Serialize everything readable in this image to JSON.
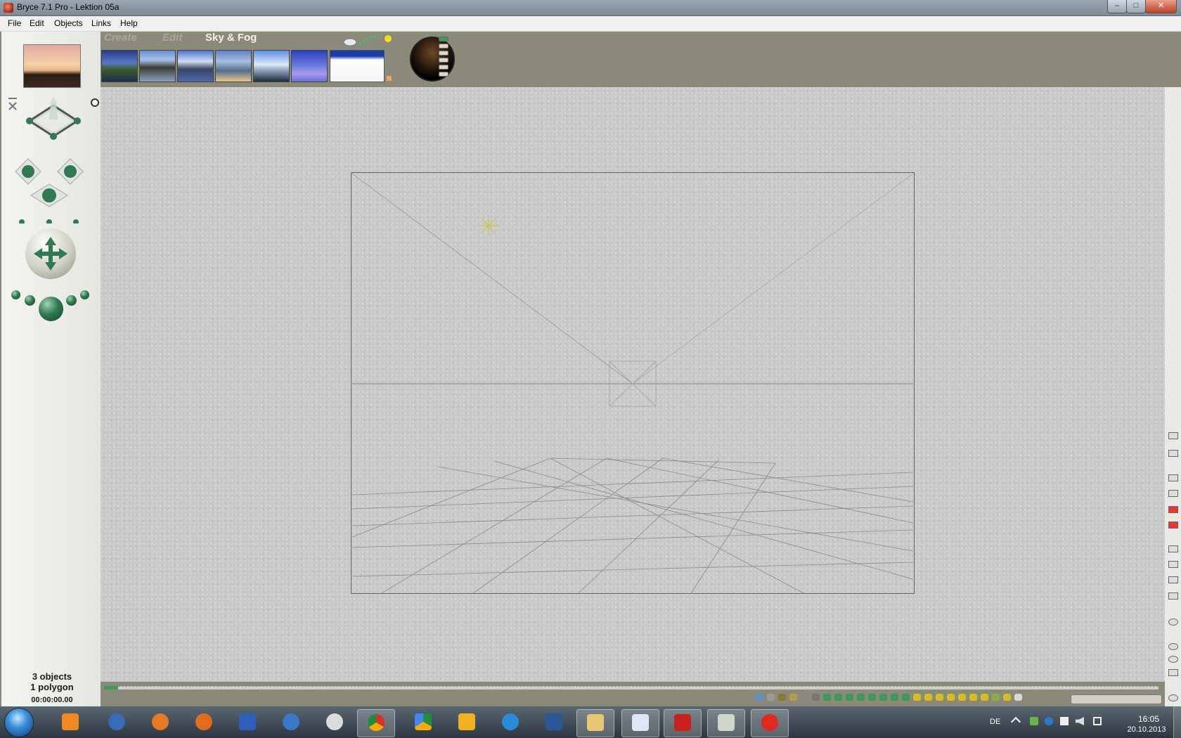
{
  "window": {
    "title": "Bryce 7.1  Pro - Lektion 05a",
    "minimize_icon": "minimize-icon",
    "maximize_icon": "maximize-icon",
    "close_icon": "close-icon"
  },
  "menu": [
    "File",
    "Edit",
    "Objects",
    "Links",
    "Help"
  ],
  "palette_tabs": {
    "create": "Create",
    "edit": "Edit",
    "sky_fog": "Sky & Fog"
  },
  "status": {
    "objects": "3 objects",
    "polygons": "1 polygon",
    "time": "00:00:00.00"
  },
  "taskbar": {
    "language": "DE",
    "time": "16:05",
    "date": "20.10.2013"
  },
  "colors": {
    "workspace": "#8b8a7a",
    "canvas": "#c9c9c9",
    "accent_green": "#2f7a52"
  }
}
